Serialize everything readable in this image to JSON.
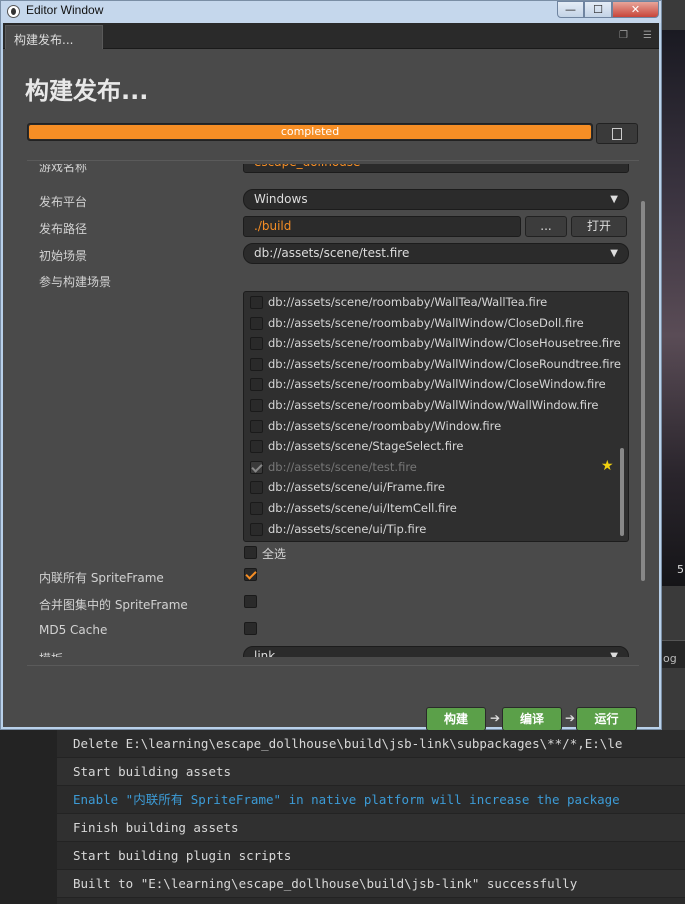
{
  "window": {
    "title": "Editor Window",
    "btn_min": "—",
    "btn_max": "☐",
    "btn_close": "✕"
  },
  "tab": {
    "label": "构建发布..."
  },
  "panel": {
    "heading": "构建发布...",
    "progress": {
      "percent": 100,
      "text": "completed"
    },
    "fields": {
      "game_name": {
        "label": "游戏名称",
        "value": "escape_dollhouse"
      },
      "platform": {
        "label": "发布平台",
        "value": "Windows"
      },
      "path": {
        "label": "发布路径",
        "value": "./build",
        "browse": "...",
        "open": "打开"
      },
      "start_scene": {
        "label": "初始场景",
        "value": "db://assets/scene/test.fire"
      },
      "scenes": {
        "label": "参与构建场景",
        "items": [
          {
            "path": "db://assets/scene/roombaby/WallTea/WallTea.fire",
            "checked": false,
            "dim": false
          },
          {
            "path": "db://assets/scene/roombaby/WallWindow/CloseDoll.fire",
            "checked": false,
            "dim": false
          },
          {
            "path": "db://assets/scene/roombaby/WallWindow/CloseHousetree.fire",
            "checked": false,
            "dim": false
          },
          {
            "path": "db://assets/scene/roombaby/WallWindow/CloseRoundtree.fire",
            "checked": false,
            "dim": false
          },
          {
            "path": "db://assets/scene/roombaby/WallWindow/CloseWindow.fire",
            "checked": false,
            "dim": false
          },
          {
            "path": "db://assets/scene/roombaby/WallWindow/WallWindow.fire",
            "checked": false,
            "dim": false
          },
          {
            "path": "db://assets/scene/roombaby/Window.fire",
            "checked": false,
            "dim": false
          },
          {
            "path": "db://assets/scene/StageSelect.fire",
            "checked": false,
            "dim": false
          },
          {
            "path": "db://assets/scene/test.fire",
            "checked": true,
            "dim": true,
            "star": true
          },
          {
            "path": "db://assets/scene/ui/Frame.fire",
            "checked": false,
            "dim": false
          },
          {
            "path": "db://assets/scene/ui/ItemCell.fire",
            "checked": false,
            "dim": false
          },
          {
            "path": "db://assets/scene/ui/Tip.fire",
            "checked": false,
            "dim": false
          }
        ],
        "select_all": "全选"
      },
      "inline_sprite": {
        "label": "内联所有 SpriteFrame",
        "checked": true
      },
      "merge_sprite": {
        "label": "合并图集中的 SpriteFrame",
        "checked": false
      },
      "md5": {
        "label": "MD5 Cache",
        "checked": false
      },
      "template": {
        "label": "模板",
        "value": "link"
      }
    },
    "actions": {
      "build": "构建",
      "compile": "编译",
      "run": "运行"
    }
  },
  "console": {
    "lines": [
      {
        "text": "Delete E:\\learning\\escape_dollhouse\\build\\jsb-link\\subpackages\\**/*,E:\\le",
        "type": "normal"
      },
      {
        "text": "Start building assets",
        "type": "normal"
      },
      {
        "text": "Enable \"内联所有 SpriteFrame\" in native platform will increase the package",
        "type": "info"
      },
      {
        "text": "Finish building assets",
        "type": "normal"
      },
      {
        "text": "Start building plugin scripts",
        "type": "normal"
      },
      {
        "text": "Built to \"E:\\learning\\escape_dollhouse\\build\\jsb-link\" successfully",
        "type": "normal"
      }
    ]
  },
  "background": {
    "photo_label": "5",
    "log_tag": "og"
  },
  "colors": {
    "accent": "#f68e25",
    "action_green": "#5ba049",
    "info_blue": "#3c9bd6"
  }
}
